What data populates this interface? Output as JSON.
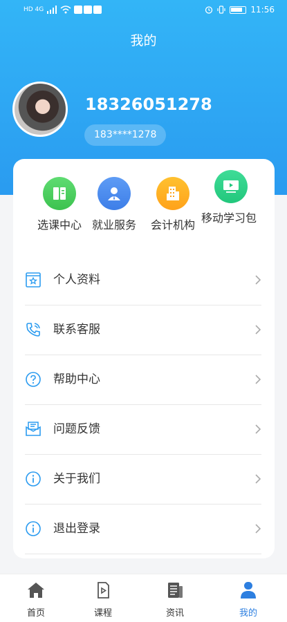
{
  "status_bar": {
    "left_text": "HD 4G",
    "time": "11:56"
  },
  "header": {
    "title": "我的",
    "user_name": "18326051278",
    "user_phone_masked": "183****1278"
  },
  "quick_actions": [
    {
      "label": "选课中心",
      "icon": "book-icon",
      "color": "#4cd25f"
    },
    {
      "label": "就业服务",
      "icon": "person-icon",
      "color": "#4f8ef0"
    },
    {
      "label": "会计机构",
      "icon": "building-icon",
      "color": "#ffb020"
    },
    {
      "label": "移动学习包",
      "icon": "video-icon",
      "color": "#31d48b"
    }
  ],
  "menu": [
    {
      "label": "个人资料",
      "icon": "profile-card-icon"
    },
    {
      "label": "联系客服",
      "icon": "phone-icon"
    },
    {
      "label": "帮助中心",
      "icon": "help-icon"
    },
    {
      "label": "问题反馈",
      "icon": "feedback-icon"
    },
    {
      "label": "关于我们",
      "icon": "info-icon"
    },
    {
      "label": "退出登录",
      "icon": "logout-info-icon"
    }
  ],
  "tabbar": [
    {
      "label": "首页",
      "icon": "home-icon",
      "active": false
    },
    {
      "label": "课程",
      "icon": "course-icon",
      "active": false
    },
    {
      "label": "资讯",
      "icon": "news-icon",
      "active": false
    },
    {
      "label": "我的",
      "icon": "user-icon",
      "active": true
    }
  ],
  "colors": {
    "header_gradient_top": "#33b5f7",
    "header_gradient_bottom": "#2a9bf0",
    "active_tab": "#2d7fe0",
    "menu_icon": "#2a9bf0"
  }
}
